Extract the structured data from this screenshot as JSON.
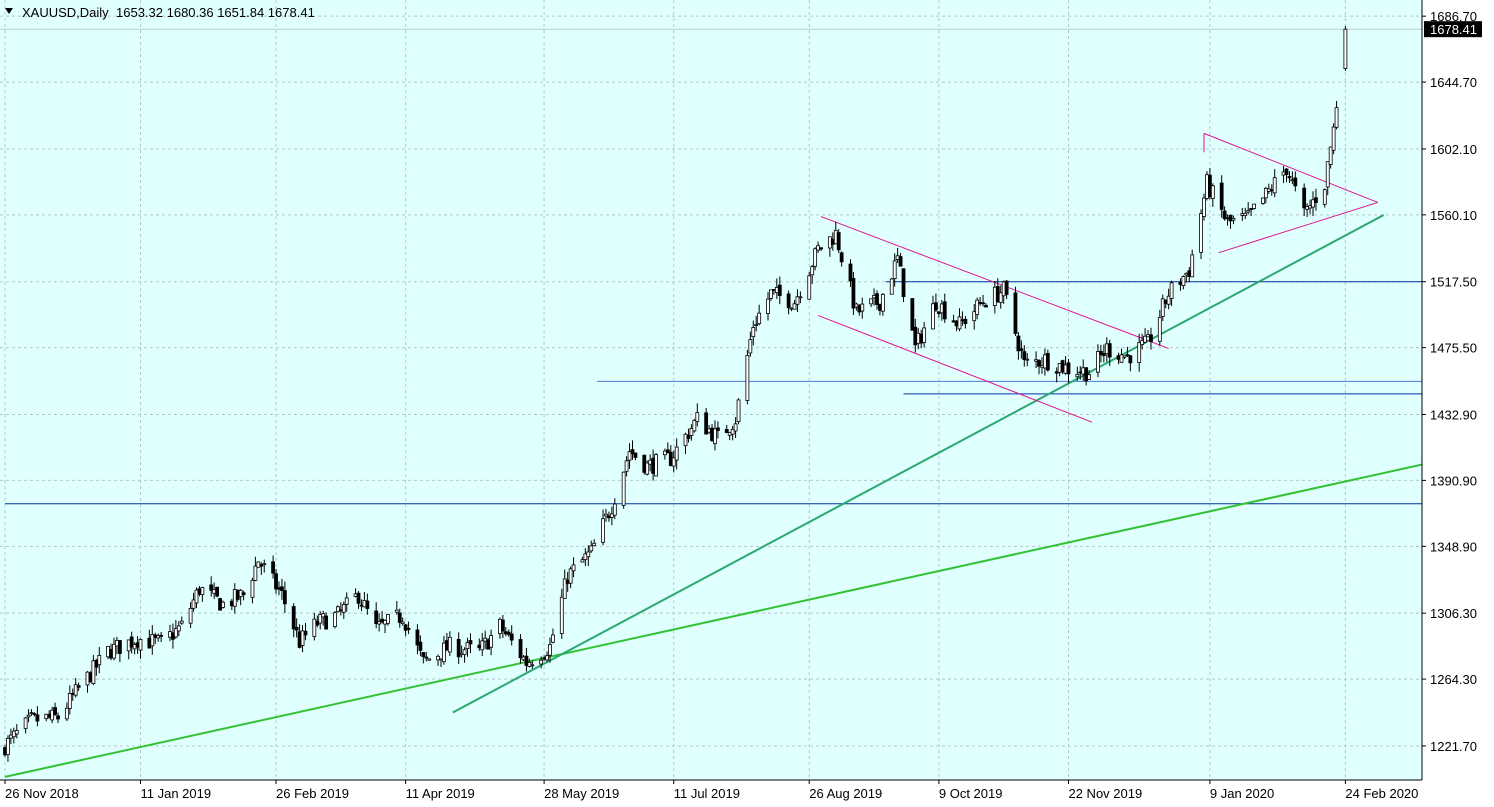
{
  "chart_data": {
    "type": "candlestick",
    "symbol": "XAUUSD,Daily",
    "ohlc_header": "1653.32 1680.36 1651.84 1678.41",
    "last_price": 1678.41,
    "last_price_label": "1678.41",
    "y_range": [
      1200.0,
      1697.0
    ],
    "y_ticks": [
      {
        "value": 1686.7,
        "label": "1686.70"
      },
      {
        "value": 1644.7,
        "label": "1644.70"
      },
      {
        "value": 1602.1,
        "label": "1602.10"
      },
      {
        "value": 1560.1,
        "label": "1560.10"
      },
      {
        "value": 1517.5,
        "label": "1517.50"
      },
      {
        "value": 1475.5,
        "label": "1475.50"
      },
      {
        "value": 1432.9,
        "label": "1432.90"
      },
      {
        "value": 1390.9,
        "label": "1390.90"
      },
      {
        "value": 1348.9,
        "label": "1348.90"
      },
      {
        "value": 1306.3,
        "label": "1306.30"
      },
      {
        "value": 1264.3,
        "label": "1264.30"
      },
      {
        "value": 1221.7,
        "label": "1221.70"
      }
    ],
    "x_ticks": [
      {
        "date": "2018-11-26",
        "label": "26 Nov 2018"
      },
      {
        "date": "2019-01-11",
        "label": "11 Jan 2019"
      },
      {
        "date": "2019-02-26",
        "label": "26 Feb 2019"
      },
      {
        "date": "2019-04-11",
        "label": "11 Apr 2019"
      },
      {
        "date": "2019-05-28",
        "label": "28 May 2019"
      },
      {
        "date": "2019-07-11",
        "label": "11 Jul 2019"
      },
      {
        "date": "2019-08-26",
        "label": "26 Aug 2019"
      },
      {
        "date": "2019-10-09",
        "label": "9 Oct 2019"
      },
      {
        "date": "2019-11-22",
        "label": "22 Nov 2019"
      },
      {
        "date": "2020-01-09",
        "label": "9 Jan 2020"
      },
      {
        "date": "2020-02-24",
        "label": "24 Feb 2020"
      }
    ],
    "x_range": [
      "2018-11-26",
      "2020-03-21"
    ],
    "close_path": [
      [
        "2018-11-26",
        1222
      ],
      [
        "2018-12-05",
        1238
      ],
      [
        "2018-12-14",
        1240
      ],
      [
        "2018-12-21",
        1258
      ],
      [
        "2018-12-31",
        1282
      ],
      [
        "2019-01-10",
        1290
      ],
      [
        "2019-01-18",
        1287
      ],
      [
        "2019-01-25",
        1298
      ],
      [
        "2019-01-31",
        1322
      ],
      [
        "2019-02-08",
        1312
      ],
      [
        "2019-02-15",
        1318
      ],
      [
        "2019-02-20",
        1340
      ],
      [
        "2019-02-28",
        1318
      ],
      [
        "2019-03-06",
        1288
      ],
      [
        "2019-03-12",
        1300
      ],
      [
        "2019-03-19",
        1305
      ],
      [
        "2019-03-26",
        1318
      ],
      [
        "2019-04-01",
        1296
      ],
      [
        "2019-04-10",
        1305
      ],
      [
        "2019-04-17",
        1275
      ],
      [
        "2019-04-26",
        1285
      ],
      [
        "2019-05-06",
        1282
      ],
      [
        "2019-05-13",
        1298
      ],
      [
        "2019-05-22",
        1275
      ],
      [
        "2019-05-30",
        1285
      ],
      [
        "2019-06-05",
        1330
      ],
      [
        "2019-06-13",
        1345
      ],
      [
        "2019-06-20",
        1375
      ],
      [
        "2019-06-26",
        1410
      ],
      [
        "2019-07-02",
        1400
      ],
      [
        "2019-07-10",
        1405
      ],
      [
        "2019-07-19",
        1430
      ],
      [
        "2019-07-26",
        1418
      ],
      [
        "2019-08-01",
        1430
      ],
      [
        "2019-08-07",
        1490
      ],
      [
        "2019-08-13",
        1510
      ],
      [
        "2019-08-21",
        1505
      ],
      [
        "2019-08-29",
        1538
      ],
      [
        "2019-09-04",
        1548
      ],
      [
        "2019-09-11",
        1498
      ],
      [
        "2019-09-19",
        1505
      ],
      [
        "2019-09-25",
        1532
      ],
      [
        "2019-10-01",
        1475
      ],
      [
        "2019-10-08",
        1505
      ],
      [
        "2019-10-16",
        1490
      ],
      [
        "2019-10-24",
        1505
      ],
      [
        "2019-10-31",
        1512
      ],
      [
        "2019-11-07",
        1465
      ],
      [
        "2019-11-14",
        1468
      ],
      [
        "2019-11-22",
        1462
      ],
      [
        "2019-11-29",
        1460
      ],
      [
        "2019-12-05",
        1475
      ],
      [
        "2019-12-12",
        1470
      ],
      [
        "2019-12-19",
        1478
      ],
      [
        "2019-12-26",
        1510
      ],
      [
        "2020-01-02",
        1525
      ],
      [
        "2020-01-08",
        1580
      ],
      [
        "2020-01-15",
        1555
      ],
      [
        "2020-01-22",
        1558
      ],
      [
        "2020-01-29",
        1575
      ],
      [
        "2020-02-04",
        1590
      ],
      [
        "2020-02-10",
        1560
      ],
      [
        "2020-02-17",
        1580
      ],
      [
        "2020-02-20",
        1615
      ],
      [
        "2020-02-24",
        1678
      ]
    ],
    "annotations": [
      {
        "kind": "hline",
        "price": 1517.5,
        "from": "2019-09-21",
        "to": "2020-03-21",
        "color": "#0033a0"
      },
      {
        "kind": "hline",
        "price": 1454,
        "from": "2019-06-15",
        "to": "2020-03-21",
        "color": "#4a7ad8"
      },
      {
        "kind": "hline",
        "price": 1446,
        "from": "2019-09-27",
        "to": "2020-03-21",
        "color": "#0033a0"
      },
      {
        "kind": "hline",
        "price": 1376,
        "from": "2018-11-26",
        "to": "2020-03-21",
        "color": "#0033a0"
      },
      {
        "kind": "line",
        "x1": "2018-11-26",
        "y1": 1202,
        "x2": "2020-03-21",
        "y2": 1401,
        "color": "#33c233"
      },
      {
        "kind": "line",
        "x1": "2019-04-27",
        "y1": 1243,
        "x2": "2020-03-08",
        "y2": 1560,
        "color": "#2aa870"
      },
      {
        "kind": "line",
        "x1": "2019-08-30",
        "y1": 1559,
        "x2": "2019-12-26",
        "y2": 1475,
        "color": "#e0148c"
      },
      {
        "kind": "line",
        "x1": "2019-08-29",
        "y1": 1496,
        "x2": "2019-11-30",
        "y2": 1428,
        "color": "#e0148c"
      },
      {
        "kind": "line",
        "x1": "2020-01-07",
        "y1": 1612,
        "x2": "2020-03-06",
        "y2": 1568,
        "color": "#e0148c"
      },
      {
        "kind": "line",
        "x1": "2020-01-12",
        "y1": 1536,
        "x2": "2020-03-06",
        "y2": 1568,
        "color": "#e0148c"
      },
      {
        "kind": "vline",
        "date": "2020-01-07",
        "from": 1600,
        "to": 1612,
        "color": "#e0148c"
      }
    ],
    "colors": {
      "background": "#e0ffff",
      "grid": "#b6c8c8",
      "candle_up": "#ffffff",
      "candle_down": "#000000",
      "wick": "#000000",
      "last_price_box": "#000000"
    },
    "grid": true
  }
}
